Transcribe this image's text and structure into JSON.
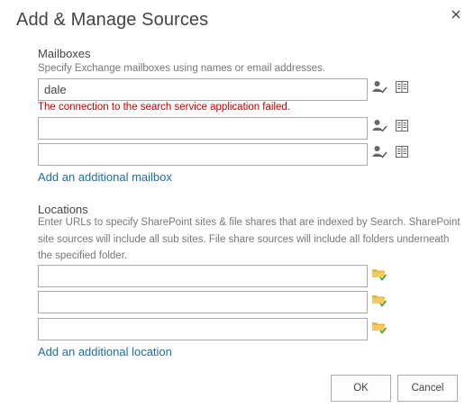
{
  "dialog": {
    "title": "Add & Manage Sources",
    "close_icon": "close-icon"
  },
  "mailboxes": {
    "label": "Mailboxes",
    "description": "Specify Exchange mailboxes using names or email addresses.",
    "inputs": [
      {
        "value": "dale"
      },
      {
        "value": ""
      },
      {
        "value": ""
      }
    ],
    "error": "The connection to the search service application failed.",
    "add_link": "Add an additional mailbox",
    "check_names_icon": "check-names-icon",
    "address_book_icon": "address-book-icon"
  },
  "locations": {
    "label": "Locations",
    "description_lines": [
      "Enter URLs to specify SharePoint sites & file shares that are indexed by Search. SharePoint",
      "site sources will include all sub sites. File share sources will include all folders underneath",
      "the specified folder."
    ],
    "inputs": [
      {
        "value": ""
      },
      {
        "value": ""
      },
      {
        "value": ""
      }
    ],
    "add_link": "Add an additional location",
    "browse_icon": "folder-check-icon"
  },
  "buttons": {
    "ok_label": "OK",
    "cancel_label": "Cancel"
  },
  "colors": {
    "error": "#c00000",
    "link": "#1e6ca3",
    "folder": "#e8b54a",
    "check": "#3c9a3c"
  }
}
